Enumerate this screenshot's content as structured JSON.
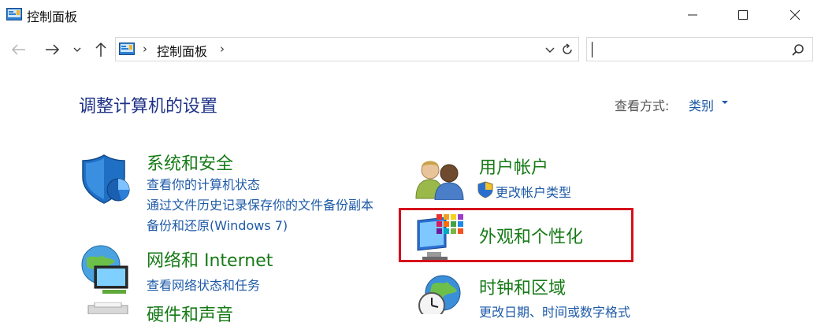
{
  "window": {
    "title": "控制面板",
    "controls": {
      "minimize_icon": "minimize-icon",
      "maximize_icon": "maximize-icon",
      "close_icon": "close-icon"
    }
  },
  "nav": {
    "back_icon": "arrow-left-icon",
    "forward_icon": "arrow-right-icon",
    "recent_icon": "chevron-down-icon",
    "up_icon": "arrow-up-icon",
    "address": {
      "path": "控制面板",
      "separator": "›",
      "dropdown_icon": "chevron-down-icon",
      "refresh_icon": "refresh-icon"
    },
    "search": {
      "value": "",
      "icon": "search-icon"
    }
  },
  "main": {
    "title": "调整计算机的设置",
    "view_by": {
      "label": "查看方式:",
      "value": "类别"
    },
    "categories": [
      {
        "title": "系统和安全",
        "links": [
          "查看你的计算机状态",
          "通过文件历史记录保存你的文件备份副本",
          "备份和还原(Windows 7)"
        ],
        "icon": "shield-icon"
      },
      {
        "title": "网络和 Internet",
        "links": [
          "查看网络状态和任务"
        ],
        "icon": "network-globe-icon"
      },
      {
        "title": "硬件和声音",
        "links": [],
        "icon": "printer-icon"
      },
      {
        "title": "用户帐户",
        "links": [
          "更改帐户类型"
        ],
        "icon": "users-icon",
        "link_icon": "uac-shield-icon"
      },
      {
        "title": "外观和个性化",
        "links": [],
        "icon": "monitor-palette-icon",
        "highlighted": true,
        "highlight_color": "#d4101c"
      },
      {
        "title": "时钟和区域",
        "links": [
          "更改日期、时间或数字格式"
        ],
        "icon": "clock-globe-icon"
      }
    ]
  },
  "colors": {
    "title_blue": "#1e3287",
    "category_green": "#167a16",
    "link_blue": "#1e5aa8",
    "highlight_red": "#d4101c"
  }
}
